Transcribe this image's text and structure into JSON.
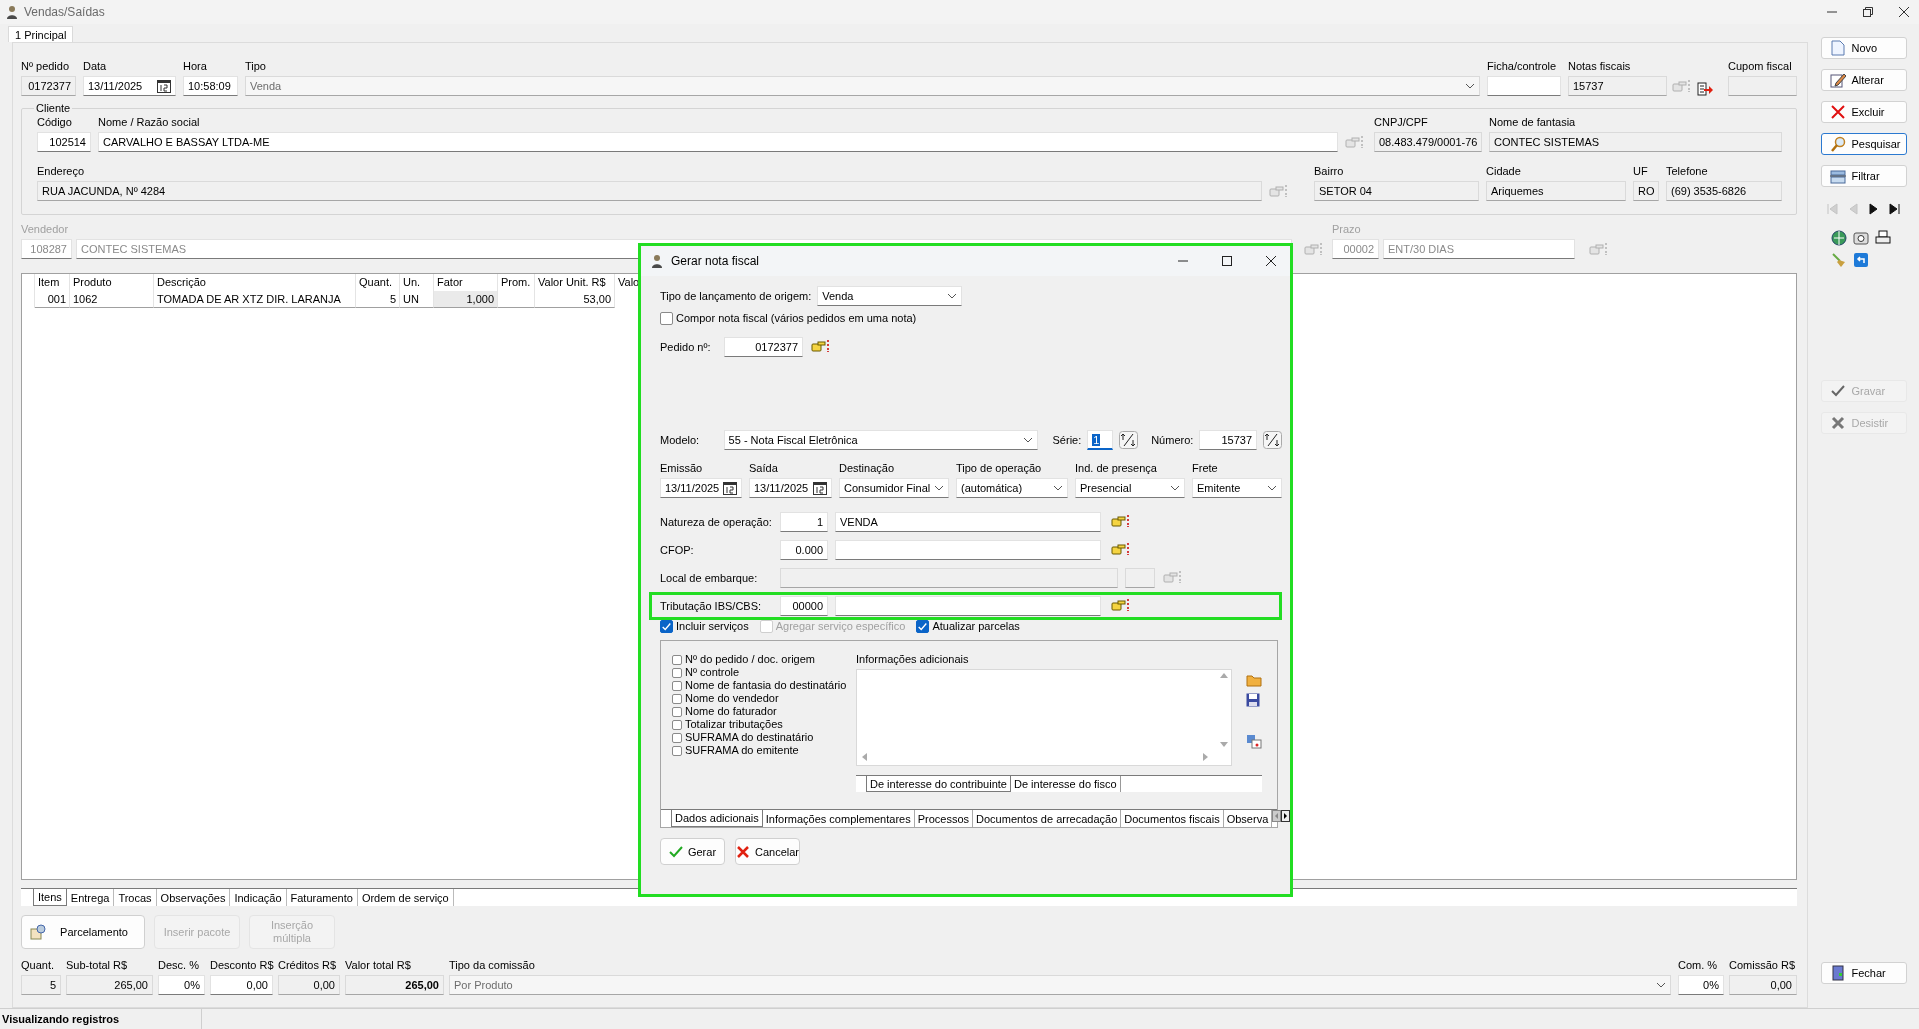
{
  "window": {
    "title": "Vendas/Saídas"
  },
  "tabs": [
    {
      "label": "1 Principal",
      "selected": true
    }
  ],
  "header_fields": [
    {
      "label": "Nº pedido",
      "value": "0172377",
      "kind": "number",
      "readonly": true
    },
    {
      "label": "Data",
      "value": "13/11/2025",
      "kind": "date",
      "readonly": false
    },
    {
      "label": "Hora",
      "value": "10:58:09",
      "kind": "text",
      "readonly": false
    },
    {
      "label": "Tipo",
      "value": "Venda",
      "kind": "combo",
      "readonly": true
    },
    {
      "label": "Ficha/controle",
      "kind": "text",
      "readonly": false
    },
    {
      "label": "Notas fiscais",
      "value": "15737",
      "kind": "text",
      "readonly": true
    },
    {
      "label": "Cupom fiscal",
      "kind": "text",
      "readonly": true
    }
  ],
  "cliente": {
    "title": "Cliente",
    "fields": [
      {
        "label": "Código",
        "value": "102514",
        "kind": "number",
        "readonly": false
      },
      {
        "label": "Nome / Razão social",
        "value": "CARVALHO E BASSAY LTDA-ME",
        "kind": "text",
        "readonly": false
      },
      {
        "label": "CNPJ/CPF",
        "value": "08.483.479/0001-76",
        "kind": "text",
        "readonly": true
      },
      {
        "label": "Nome de fantasia",
        "value": "CONTEC SISTEMAS",
        "kind": "text",
        "readonly": true
      },
      {
        "label": "Endereço",
        "value": "RUA JACUNDA, Nº 4284",
        "kind": "text",
        "readonly": true
      },
      {
        "label": "Bairro",
        "value": "SETOR 04",
        "kind": "text",
        "readonly": true
      },
      {
        "label": "Cidade",
        "value": "Ariquemes",
        "kind": "text",
        "readonly": true
      },
      {
        "label": "UF",
        "value": "RO",
        "kind": "text",
        "readonly": true
      },
      {
        "label": "Telefone",
        "value": "(69) 3535-6826",
        "kind": "text",
        "readonly": true
      }
    ]
  },
  "vendedor": {
    "label": "Vendedor",
    "disabled": true,
    "code": "108287",
    "name": "CONTEC SISTEMAS"
  },
  "prazo": {
    "label": "Prazo",
    "disabled": true,
    "code": "00002",
    "name": "ENT/30 DIAS"
  },
  "items_table": {
    "columns": [
      "Item",
      "Produto",
      "Descrição",
      "Quant.",
      "Un.",
      "Fator",
      "Prom.",
      "Valor Unit. R$",
      "Valo"
    ],
    "rows": [
      [
        "001",
        "1062",
        "TOMADA DE AR XTZ DIR. LARANJA",
        "5",
        "UN",
        "1,000",
        null,
        "53,00"
      ]
    ]
  },
  "bottom_tabs": [
    {
      "label": "Itens",
      "selected": true
    },
    {
      "label": "Entrega",
      "selected": false
    },
    {
      "label": "Trocas",
      "selected": false
    },
    {
      "label": "Observações",
      "selected": false
    },
    {
      "label": "Indicação",
      "selected": false
    },
    {
      "label": "Faturamento",
      "selected": false
    },
    {
      "label": "Ordem de serviço",
      "selected": false
    }
  ],
  "item_buttons": [
    {
      "label": "Parcelamento",
      "disabled": false
    },
    {
      "label": "Inserir pacote",
      "disabled": true
    },
    {
      "label": "Inserção múltipla",
      "disabled": true
    }
  ],
  "totals": [
    {
      "label": "Quant.",
      "value": "5",
      "kind": "number",
      "readonly": true
    },
    {
      "label": "Sub-total R$",
      "value": "265,00",
      "kind": "number",
      "readonly": true
    },
    {
      "label": "Desc. %",
      "value": "0%",
      "kind": "number",
      "readonly": false
    },
    {
      "label": "Desconto R$",
      "value": "0,00",
      "kind": "number",
      "readonly": false
    },
    {
      "label": "Créditos R$",
      "value": "0,00",
      "kind": "number",
      "readonly": true
    },
    {
      "label": "Valor total R$",
      "value": "265,00",
      "kind": "number",
      "readonly": true
    },
    {
      "label": "Tipo da comissão",
      "value": "Por Produto",
      "kind": "combo",
      "readonly": true
    },
    {
      "label": "Com. %",
      "value": "0%",
      "kind": "number",
      "readonly": false
    },
    {
      "label": "Comissão R$",
      "value": "0,00",
      "kind": "number",
      "readonly": true
    }
  ],
  "status_bar": {
    "text": "Visualizando registros"
  },
  "side_buttons": [
    {
      "label": "Novo",
      "disabled": false,
      "focused": false
    },
    {
      "label": "Alterar",
      "disabled": false,
      "focused": false
    },
    {
      "label": "Excluir",
      "disabled": false,
      "focused": false
    },
    {
      "label": "Pesquisar",
      "disabled": false,
      "focused": true
    },
    {
      "label": "Filtrar",
      "disabled": false,
      "focused": false
    }
  ],
  "navigator": [
    {
      "disabled": true
    },
    {
      "disabled": true
    },
    {
      "disabled": false
    },
    {
      "disabled": false
    }
  ],
  "edit_buttons": [
    {
      "label": "Gravar",
      "disabled": true
    },
    {
      "label": "Desistir",
      "disabled": true
    }
  ],
  "close_button": {
    "label": "Fechar"
  },
  "dialog": {
    "title": "Gerar nota fiscal",
    "highlighted": true,
    "origin": {
      "label": "Tipo de lançamento de origem:",
      "value": "Venda"
    },
    "compose": {
      "label": "Compor nota fiscal (vários pedidos em uma nota)",
      "checked": false
    },
    "pedido": {
      "label": "Pedido nº:",
      "value": "0172377"
    },
    "modelo": {
      "label": "Modelo:",
      "value": "55 - Nota Fiscal Eletrônica"
    },
    "serie": {
      "label": "Série:",
      "value": "1",
      "selected": true
    },
    "numero": {
      "label": "Número:",
      "value": "15737"
    },
    "details": [
      {
        "label": "Emissão",
        "value": "13/11/2025",
        "kind": "date"
      },
      {
        "label": "Saída",
        "value": "13/11/2025",
        "kind": "date"
      },
      {
        "label": "Destinação",
        "value": "Consumidor Final",
        "kind": "combo"
      },
      {
        "label": "Tipo de operação",
        "value": "(automática)",
        "kind": "combo"
      },
      {
        "label": "Ind. de presença",
        "value": "Presencial",
        "kind": "combo"
      },
      {
        "label": "Frete",
        "value": "Emitente",
        "kind": "combo"
      }
    ],
    "lookups": [
      {
        "label": "Natureza de operação:",
        "code": "1",
        "description": "VENDA",
        "disabled": false,
        "highlighted": false
      },
      {
        "label": "CFOP:",
        "code": "0.000",
        "disabled": false,
        "highlighted": false
      },
      {
        "label": "Local de embarque:",
        "disabled": true,
        "highlighted": false
      },
      {
        "label": "Tributação IBS/CBS:",
        "code": "00000",
        "disabled": false,
        "highlighted": true
      }
    ],
    "options": [
      {
        "label": "Incluir serviços",
        "checked": true,
        "disabled": false
      },
      {
        "label": "Agregar serviço específico",
        "checked": false,
        "disabled": true
      },
      {
        "label": "Atualizar parcelas",
        "checked": true,
        "disabled": false
      }
    ],
    "print_options": [
      {
        "label": "Nº do pedido / doc. origem",
        "checked": false
      },
      {
        "label": "Nº controle",
        "checked": false
      },
      {
        "label": "Nome de fantasia do destinatário",
        "checked": false
      },
      {
        "label": "Nome do vendedor",
        "checked": false
      },
      {
        "label": "Nome do faturador",
        "checked": false
      },
      {
        "label": "Totalizar tributações",
        "checked": false
      },
      {
        "label": "SUFRAMA do destinatário",
        "checked": false
      },
      {
        "label": "SUFRAMA do emitente",
        "checked": false
      }
    ],
    "additional_info": {
      "label": "Informações adicionais",
      "tabs": [
        {
          "label": "De interesse do contribuinte",
          "selected": true
        },
        {
          "label": "De interesse do fisco",
          "selected": false
        }
      ]
    },
    "section_tabs": [
      {
        "label": "Dados adicionais",
        "selected": true
      },
      {
        "label": "Informações complementares",
        "selected": false
      },
      {
        "label": "Processos",
        "selected": false
      },
      {
        "label": "Documentos de arrecadação",
        "selected": false
      },
      {
        "label": "Documentos fiscais",
        "selected": false
      },
      {
        "label": "Observa",
        "selected": false
      }
    ],
    "buttons": [
      {
        "label": "Gerar"
      },
      {
        "label": "Cancelar"
      }
    ]
  }
}
